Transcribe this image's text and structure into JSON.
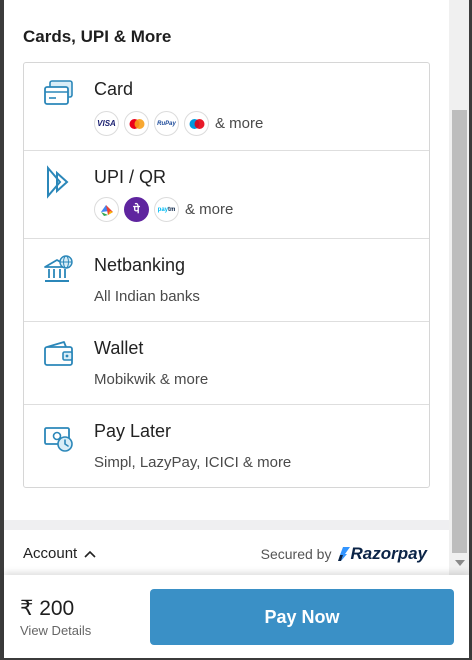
{
  "section_title": "Cards, UPI & More",
  "methods": {
    "card": {
      "title": "Card",
      "logos": [
        "VISA",
        "Mastercard",
        "RuPay",
        "Maestro"
      ],
      "more": "& more"
    },
    "upi": {
      "title": "UPI / QR",
      "logos": [
        "Google Pay",
        "PhonePe",
        "Paytm"
      ],
      "more": "& more"
    },
    "netbanking": {
      "title": "Netbanking",
      "subtitle": "All Indian banks"
    },
    "wallet": {
      "title": "Wallet",
      "subtitle": "Mobikwik & more"
    },
    "paylater": {
      "title": "Pay Later",
      "subtitle": "Simpl, LazyPay, ICICI & more"
    }
  },
  "footer": {
    "account_label": "Account",
    "secured_by": "Secured by",
    "brand": "Razorpay"
  },
  "bottom": {
    "amount": "₹ 200",
    "view_details": "View Details",
    "pay_button": "Pay Now"
  },
  "colors": {
    "accent": "#3a90c6",
    "icon": "#2b87b9",
    "razorpay": "#0b2447"
  }
}
